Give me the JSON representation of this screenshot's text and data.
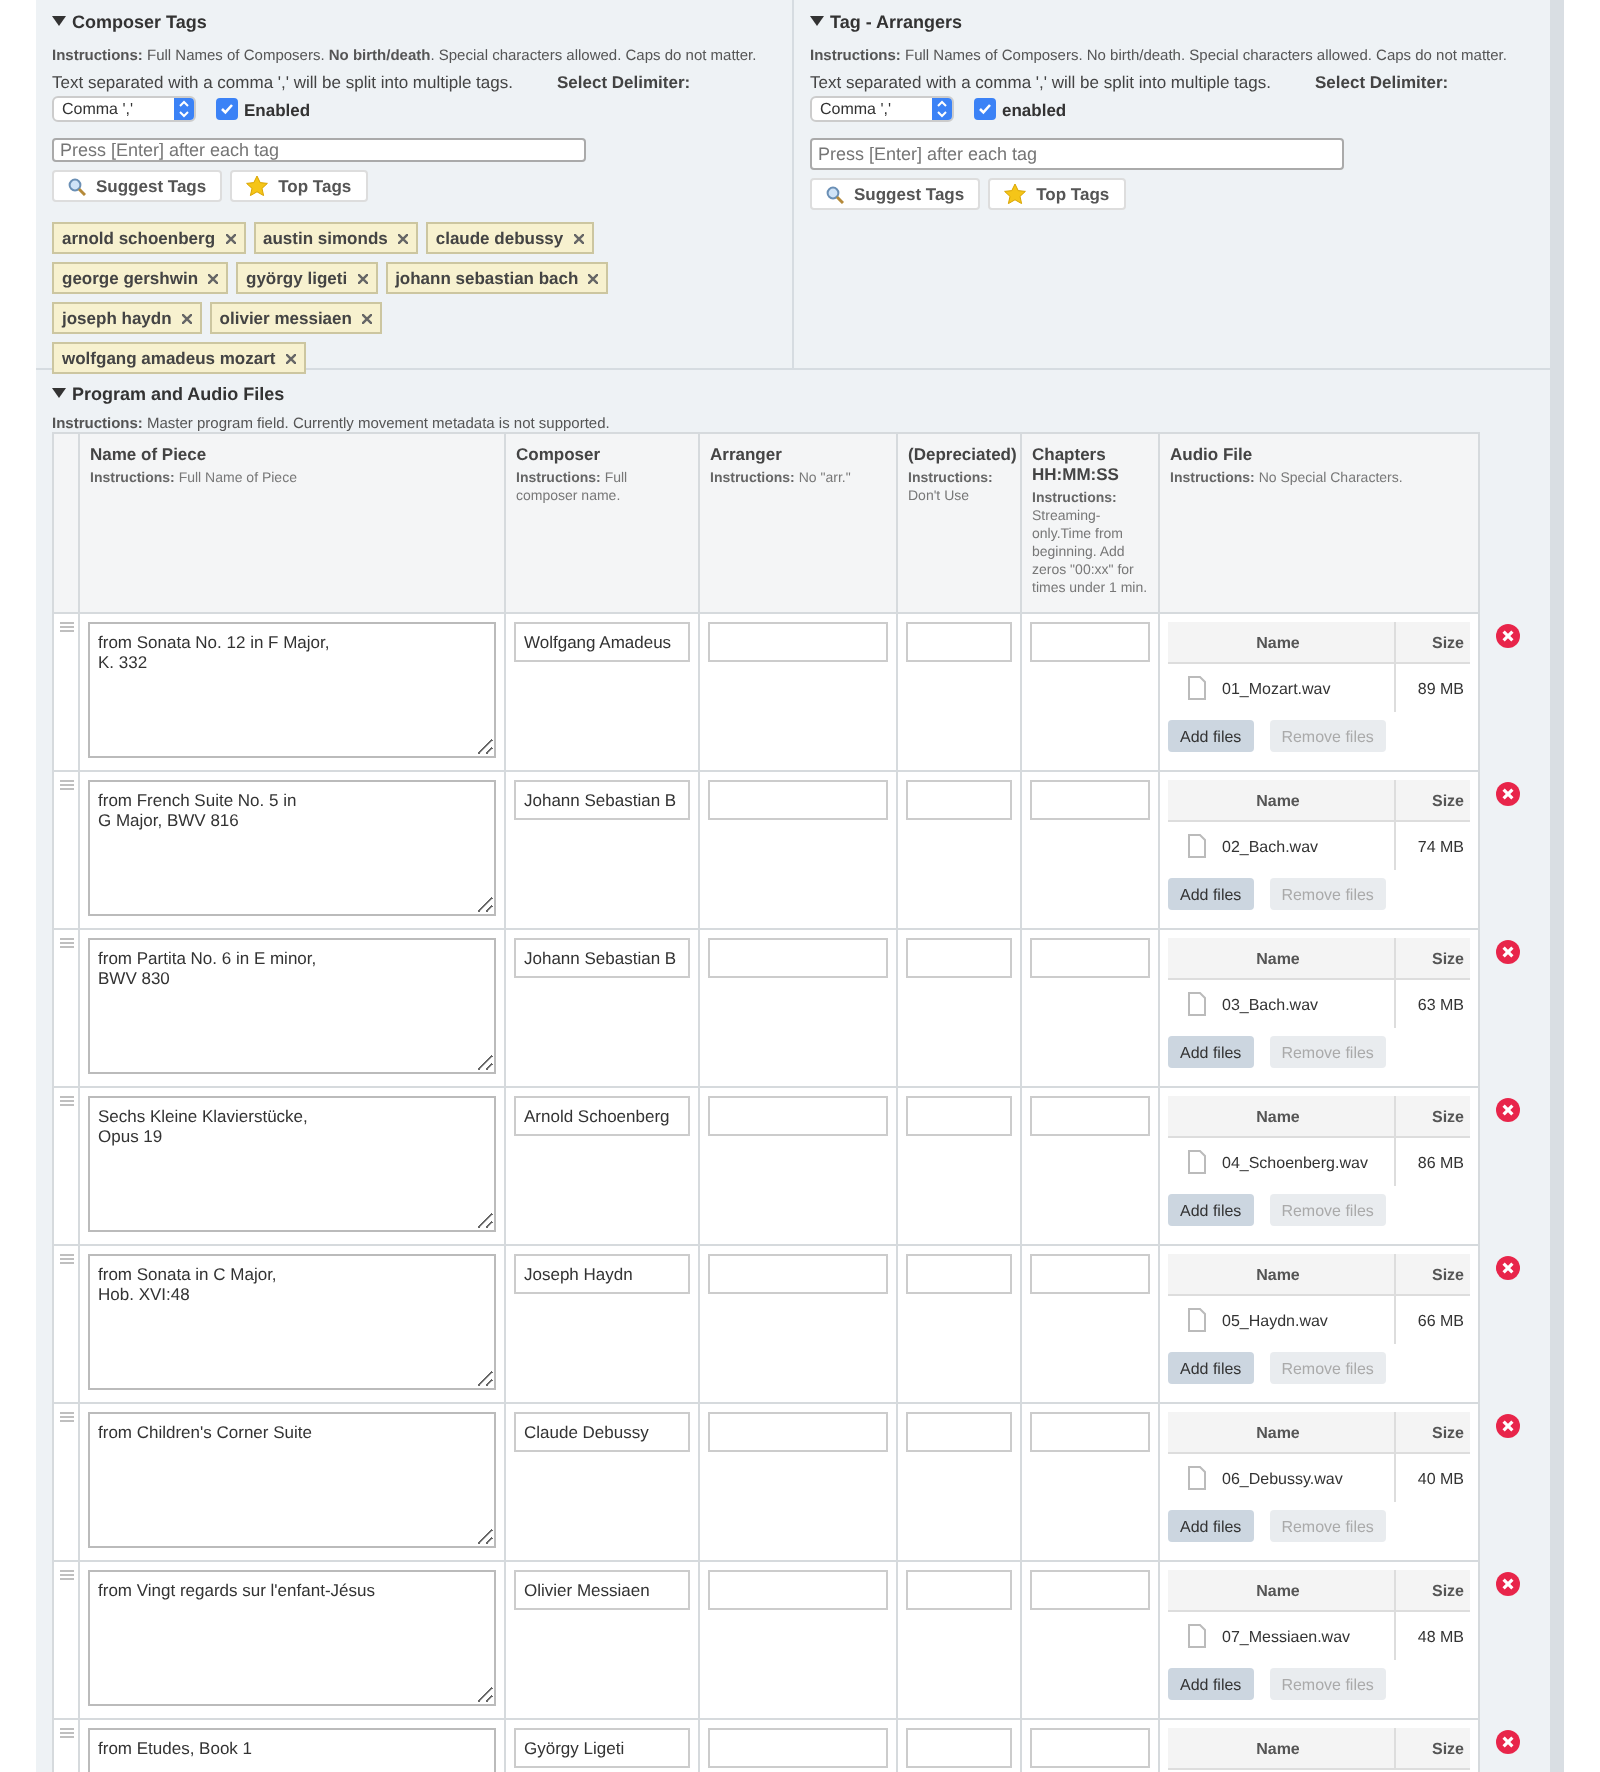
{
  "tag_sections": [
    {
      "title": "Composer Tags",
      "expanded": true,
      "instructions": "**Instructions:**  Full Names of Composers. **No birth/death**.  Special characters allowed.  Caps do not matter.",
      "delimiter_note": "Text separated with a comma ',' will be split into multiple tags.",
      "delimiter_label": "Select Delimiter:",
      "delimiter": "Comma ','",
      "enabled": {
        "label": "Enabled",
        "checked": true
      },
      "tag_input": {
        "placeholder": "Press [Enter] after each tag"
      },
      "suggest_button": "Suggest Tags",
      "top_button": "Top Tags",
      "tags": [
        "arnold schoenberg",
        "austin simonds",
        "claude debussy",
        "george gershwin",
        "györgy ligeti",
        "johann sebastian bach",
        "joseph haydn",
        "olivier messiaen",
        "wolfgang amadeus mozart"
      ]
    },
    {
      "title": "Tag - Arrangers",
      "expanded": true,
      "instructions": "**Instructions:**  Full Names of Composers. No birth/death.  Special characters allowed.  Caps do not matter.",
      "delimiter_note": "Text separated with a comma ',' will be split into multiple tags.",
      "delimiter_label": "Select Delimiter:",
      "delimiter": "Comma ','",
      "enabled": {
        "label": "enabled",
        "checked": true
      },
      "tag_input": {
        "placeholder": "Press [Enter] after each tag"
      },
      "suggest_button": "Suggest Tags",
      "top_button": "Top Tags"
    }
  ],
  "program": {
    "title": "Program and Audio Files",
    "expanded": true,
    "instructions": "**Instructions:**  Master program field.  Currently movement metadata is not supported.",
    "columns": [
      {
        "name": "Name of Piece",
        "instructions": "**Instructions:** Full Name of Piece"
      },
      {
        "name": "Composer",
        "instructions": "**Instructions:** Full composer name."
      },
      {
        "name": "Arranger",
        "instructions": "**Instructions:** No \"arr.\""
      },
      {
        "name": "(Depreciated)",
        "instructions": "**Instructions:** Don't Use"
      },
      {
        "name": "Chapters HH:MM:SS",
        "instructions": "**Instructions:** Streaming-only.Time from beginning. Add zeros \"00:xx\" for times under 1 min."
      },
      {
        "name": "Audio File",
        "instructions": "**Instructions:** No Special Characters."
      }
    ],
    "rows": [
      {
        "piece": "from Sonata No. 12 in F Major,\nK. 332",
        "composer": "Wolfgang Amadeus",
        "file_columns": [
          "Name",
          "Size"
        ],
        "files": [
          {
            "name": "01_Mozart.wav",
            "size": "89 MB"
          }
        ],
        "add_button": {
          "label": "Add files",
          "disabled": false
        },
        "remove_button": {
          "label": "Remove files",
          "disabled": true
        }
      },
      {
        "piece": "from French Suite No. 5 in\nG Major, BWV 816",
        "composer": "Johann Sebastian B",
        "file_columns": [
          "Name",
          "Size"
        ],
        "files": [
          {
            "name": "02_Bach.wav",
            "size": "74 MB"
          }
        ],
        "add_button": {
          "label": "Add files",
          "disabled": false
        },
        "remove_button": {
          "label": "Remove files",
          "disabled": true
        }
      },
      {
        "piece": "from Partita No. 6 in E minor,\nBWV 830",
        "composer": "Johann Sebastian B",
        "file_columns": [
          "Name",
          "Size"
        ],
        "files": [
          {
            "name": "03_Bach.wav",
            "size": "63 MB"
          }
        ],
        "add_button": {
          "label": "Add files",
          "disabled": false
        },
        "remove_button": {
          "label": "Remove files",
          "disabled": true
        }
      },
      {
        "piece": "Sechs Kleine Klavierstücke,\nOpus 19",
        "composer": "Arnold Schoenberg",
        "file_columns": [
          "Name",
          "Size"
        ],
        "files": [
          {
            "name": "04_Schoenberg.wav",
            "size": "86 MB"
          }
        ],
        "add_button": {
          "label": "Add files",
          "disabled": false
        },
        "remove_button": {
          "label": "Remove files",
          "disabled": true
        }
      },
      {
        "piece": "from Sonata in C Major,\nHob. XVI:48",
        "composer": "Joseph Haydn",
        "file_columns": [
          "Name",
          "Size"
        ],
        "files": [
          {
            "name": "05_Haydn.wav",
            "size": "66 MB"
          }
        ],
        "add_button": {
          "label": "Add files",
          "disabled": false
        },
        "remove_button": {
          "label": "Remove files",
          "disabled": true
        }
      },
      {
        "piece": "from Children's Corner Suite",
        "composer": "Claude Debussy",
        "file_columns": [
          "Name",
          "Size"
        ],
        "files": [
          {
            "name": "06_Debussy.wav",
            "size": "40 MB"
          }
        ],
        "add_button": {
          "label": "Add files",
          "disabled": false
        },
        "remove_button": {
          "label": "Remove files",
          "disabled": true
        }
      },
      {
        "piece": "from Vingt regards sur l'enfant-Jésus",
        "composer": "Olivier Messiaen",
        "file_columns": [
          "Name",
          "Size"
        ],
        "files": [
          {
            "name": "07_Messiaen.wav",
            "size": "48 MB"
          }
        ],
        "add_button": {
          "label": "Add files",
          "disabled": false
        },
        "remove_button": {
          "label": "Remove files",
          "disabled": true
        }
      },
      {
        "piece": "from Etudes, Book 1",
        "composer": "György Ligeti",
        "file_columns": [
          "Name",
          "Size"
        ]
      }
    ]
  }
}
